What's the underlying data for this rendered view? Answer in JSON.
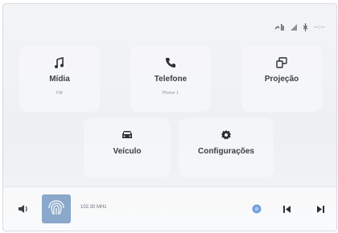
{
  "status_bar": {
    "icons": [
      "phone-signal-icon",
      "wifi-icon",
      "bluetooth-icon",
      "time-placeholder"
    ],
    "clock": "--:--"
  },
  "tiles": [
    {
      "key": "midia",
      "label": "Mídia",
      "sub": "FM",
      "icon": "music-note-icon"
    },
    {
      "key": "telefone",
      "label": "Telefone",
      "sub": "Phone 1",
      "icon": "phone-icon"
    },
    {
      "key": "projecao",
      "label": "Projeção",
      "sub": "",
      "icon": "projection-icon"
    },
    {
      "key": "veiculo",
      "label": "Veículo",
      "sub": "",
      "icon": "car-icon"
    },
    {
      "key": "configuracoes",
      "label": "Configurações",
      "sub": "",
      "icon": "gear-icon"
    }
  ],
  "media_bar": {
    "station": "102.30 MHz",
    "album_icon": "radio-signal-icon",
    "icons": [
      "volume-icon",
      "favorite-icon",
      "previous-track-icon",
      "next-track-icon"
    ]
  },
  "colors": {
    "background": "#eef0f3",
    "icon_dark": "#2b2f36",
    "accent_blue": "#6f9fdc",
    "album_art": "#8aa8c9"
  }
}
